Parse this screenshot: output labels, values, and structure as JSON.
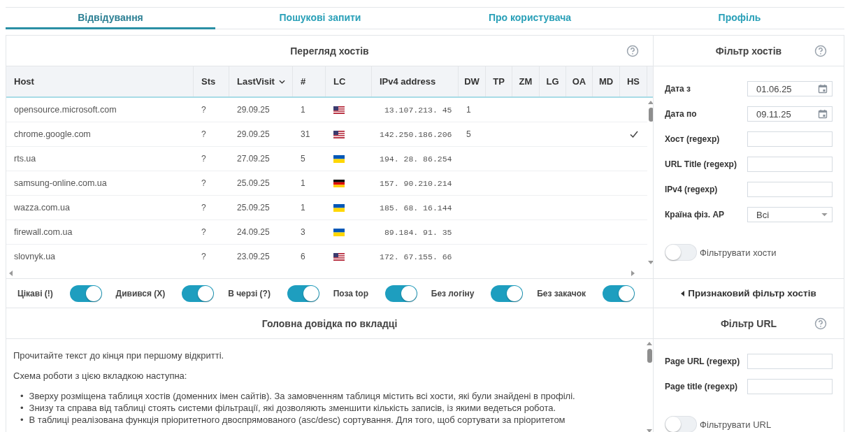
{
  "tabs": [
    {
      "label": "Відвідування",
      "selected": true
    },
    {
      "label": "Пошукові запити",
      "selected": false
    },
    {
      "label": "Про користувача",
      "selected": false
    },
    {
      "label": "Профіль",
      "selected": false
    }
  ],
  "hosts_panel": {
    "title": "Перегляд хостів",
    "columns": [
      {
        "label": "Host",
        "sorted": false
      },
      {
        "label": "Sts",
        "sorted": false
      },
      {
        "label": "LastVisit",
        "sorted": true
      },
      {
        "label": "#",
        "sorted": false
      },
      {
        "label": "LC",
        "sorted": false
      },
      {
        "label": "IPv4 address",
        "sorted": false
      },
      {
        "label": "DW",
        "sorted": false
      },
      {
        "label": "TP",
        "sorted": false
      },
      {
        "label": "ZM",
        "sorted": false
      },
      {
        "label": "LG",
        "sorted": false
      },
      {
        "label": "OA",
        "sorted": false
      },
      {
        "label": "MD",
        "sorted": false
      },
      {
        "label": "HS",
        "sorted": false
      }
    ],
    "rows": [
      {
        "host": "opensource.microsoft.com",
        "sts": "?",
        "last_visit": "29.09.25",
        "count": "1",
        "flag": {
          "kind": "us"
        },
        "ip": " 13.107.213. 45",
        "dw": "1",
        "hs": false
      },
      {
        "host": "chrome.google.com",
        "sts": "?",
        "last_visit": "29.09.25",
        "count": "31",
        "flag": {
          "kind": "us"
        },
        "ip": "142.250.186.206",
        "dw": "5",
        "hs": true
      },
      {
        "host": "rts.ua",
        "sts": "?",
        "last_visit": "27.09.25",
        "count": "5",
        "flag": {
          "kind": "ua"
        },
        "ip": "194. 28. 86.254",
        "hs": false
      },
      {
        "host": "samsung-online.com.ua",
        "sts": "?",
        "last_visit": "25.09.25",
        "count": "1",
        "flag": {
          "kind": "de"
        },
        "ip": "157. 90.210.214",
        "hs": false
      },
      {
        "host": "wazza.com.ua",
        "sts": "?",
        "last_visit": "25.09.25",
        "count": "1",
        "flag": {
          "kind": "ua"
        },
        "ip": "185. 68. 16.144",
        "hs": false
      },
      {
        "host": "firewall.com.ua",
        "sts": "?",
        "last_visit": "24.09.25",
        "count": "3",
        "flag": {
          "kind": "ua"
        },
        "ip": " 89.184. 91. 35",
        "hs": false
      },
      {
        "host": "slovnyk.ua",
        "sts": "?",
        "last_visit": "23.09.25",
        "count": "6",
        "flag": {
          "kind": "us"
        },
        "ip": "172. 67.155. 66",
        "hs": false
      }
    ],
    "switches": [
      {
        "label": "Цікаві (!)",
        "on": true
      },
      {
        "label": "Дивився (X)",
        "on": true
      },
      {
        "label": "В черзі (?)",
        "on": true
      },
      {
        "label": "Поза top",
        "on": true
      },
      {
        "label": "Без логіну",
        "on": true
      },
      {
        "label": "Без закачок",
        "on": true
      }
    ]
  },
  "help_panel": {
    "title": "Головна довідка по вкладці",
    "paragraphs": [
      "Прочитайте текст до кінця при першому відкритті.",
      "Схема роботи з цією вкладкою наступна:"
    ],
    "bullets": [
      {
        "marker": "•",
        "text": "Зверху розміщена таблиця хостів (доменних імен сайтів). За замовченням таблиця містить всі хости, які були знайдені в профілі."
      },
      {
        "marker": "•",
        "text": "Знизу та справа від таблиці стоять системи фільтрації, які дозволяють зменшити кількість записів, із якими ведеться робота."
      },
      {
        "marker": "•",
        "text": "В таблиці реалізована функція пріоритетного двоспрямованого (asc/desc) сортування. Для того, щоб сортувати за пріоритетом"
      }
    ]
  },
  "host_filter": {
    "title": "Фільтр хостів",
    "fields": [
      {
        "kind": "date",
        "label": "Дата з",
        "value": "01.06.25"
      },
      {
        "kind": "date",
        "label": "Дата по",
        "value": "09.11.25"
      },
      {
        "kind": "text",
        "label": "Хост (regexp)"
      },
      {
        "kind": "text",
        "label": "URL Title (regexp)"
      },
      {
        "kind": "text",
        "label": "IPv4 (regexp)"
      },
      {
        "kind": "select",
        "label": "Країна фіз. AP",
        "value": "Всі"
      }
    ],
    "toggle": {
      "label": "Фільтрувати хости",
      "on": false
    },
    "feature_filter_button": "Признаковий фільтр хостів"
  },
  "url_filter": {
    "title": "Фільтр URL",
    "fields": [
      {
        "kind": "text",
        "label": "Page URL (regexp)"
      },
      {
        "kind": "text",
        "label": "Page title (regexp)"
      }
    ],
    "toggle": {
      "label": "Фільтрувати URL",
      "on": false
    }
  }
}
